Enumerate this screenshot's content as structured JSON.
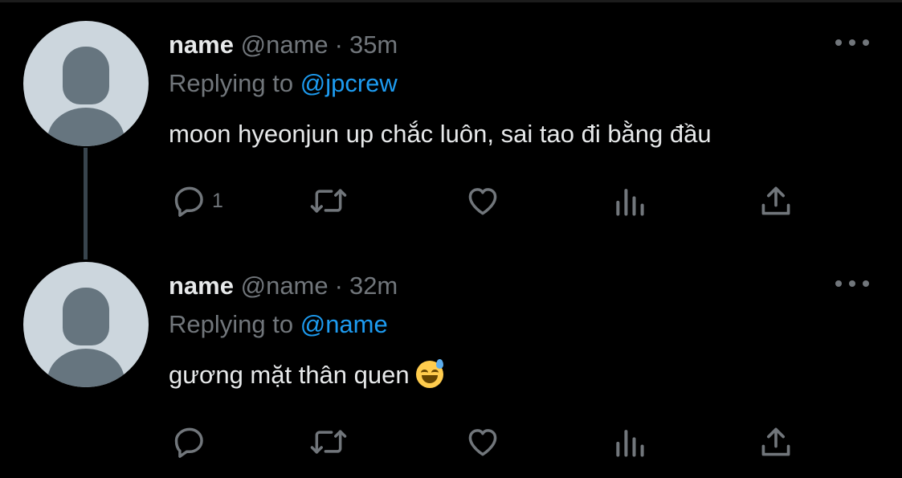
{
  "tweets": [
    {
      "name": "name",
      "handle": "@name",
      "separator": "·",
      "time": "35m",
      "replying_prefix": "Replying to",
      "replying_to": "@jpcrew",
      "text": "moon hyeonjun up chắc luôn, sai tao đi bằng đầu",
      "reply_count": "1"
    },
    {
      "name": "name",
      "handle": "@name",
      "separator": "·",
      "time": "32m",
      "replying_prefix": "Replying to",
      "replying_to": "@name",
      "text": "gương mặt thân quen",
      "emoji": "grinning-face-with-sweat",
      "reply_count": ""
    }
  ],
  "icons": [
    "reply-icon",
    "retweet-icon",
    "like-icon",
    "views-icon",
    "share-icon",
    "more-icon"
  ],
  "colors": {
    "background": "#000000",
    "text": "#e7e9ea",
    "secondary": "#71767b",
    "link": "#1d9bf0",
    "avatar_bg": "#ccd6dd",
    "avatar_fg": "#66757f",
    "thread_line": "#38444d"
  }
}
